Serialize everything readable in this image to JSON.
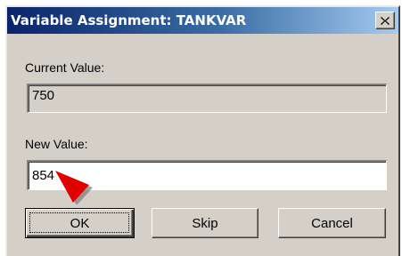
{
  "window": {
    "title": "Variable Assignment: TANKVAR",
    "close_icon": "close-icon"
  },
  "current_value": {
    "label": "Current Value:",
    "value": "750"
  },
  "new_value": {
    "label": "New Value:",
    "value": "854"
  },
  "buttons": {
    "ok": "OK",
    "skip": "Skip",
    "cancel": "Cancel"
  },
  "pointer": {
    "icon": "pointer-arrow-icon",
    "color": "#e00000"
  }
}
